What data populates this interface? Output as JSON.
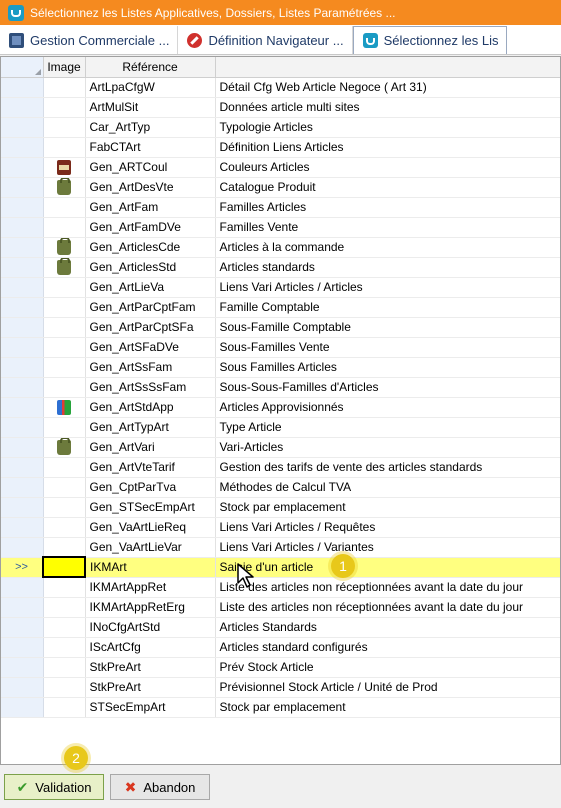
{
  "window": {
    "title": "Sélectionnez les Listes Applicatives, Dossiers, Listes Paramétrées ..."
  },
  "tabs": [
    {
      "label": "Gestion Commerciale ...",
      "icon": "cube-icon"
    },
    {
      "label": "Définition Navigateur ...",
      "icon": "no-entry-icon"
    },
    {
      "label": "Sélectionnez les Lis",
      "icon": "app-icon",
      "active": true
    }
  ],
  "grid": {
    "columns": {
      "image": "Image",
      "reference": "Référence",
      "description": ""
    },
    "current_marker": ">>",
    "rows": [
      {
        "ref": "ArtLpaCfgW",
        "desc": "Détail Cfg Web Article Negoce ( Art 31)",
        "icon": ""
      },
      {
        "ref": "ArtMulSit",
        "desc": "Données article multi sites",
        "icon": ""
      },
      {
        "ref": "Car_ArtTyp",
        "desc": "Typologie Articles",
        "icon": ""
      },
      {
        "ref": "FabCTArt",
        "desc": "Définition Liens Articles",
        "icon": ""
      },
      {
        "ref": "Gen_ARTCoul",
        "desc": "Couleurs Articles",
        "icon": "book"
      },
      {
        "ref": "Gen_ArtDesVte",
        "desc": "Catalogue Produit",
        "icon": "bag"
      },
      {
        "ref": "Gen_ArtFam",
        "desc": "Familles Articles",
        "icon": ""
      },
      {
        "ref": "Gen_ArtFamDVe",
        "desc": "Familles Vente",
        "icon": ""
      },
      {
        "ref": "Gen_ArticlesCde",
        "desc": "Articles à la commande",
        "icon": "bag"
      },
      {
        "ref": "Gen_ArticlesStd",
        "desc": "Articles standards",
        "icon": "bag"
      },
      {
        "ref": "Gen_ArtLieVa",
        "desc": "Liens Vari Articles / Articles",
        "icon": ""
      },
      {
        "ref": "Gen_ArtParCptFam",
        "desc": "Famille Comptable",
        "icon": ""
      },
      {
        "ref": "Gen_ArtParCptSFa",
        "desc": "Sous-Famille Comptable",
        "icon": ""
      },
      {
        "ref": "Gen_ArtSFaDVe",
        "desc": "Sous-Familles Vente",
        "icon": ""
      },
      {
        "ref": "Gen_ArtSsFam",
        "desc": "Sous Familles Articles",
        "icon": ""
      },
      {
        "ref": "Gen_ArtSsSsFam",
        "desc": "Sous-Sous-Familles d'Articles",
        "icon": ""
      },
      {
        "ref": "Gen_ArtStdApp",
        "desc": "Articles Approvisionnés",
        "icon": "books"
      },
      {
        "ref": "Gen_ArtTypArt",
        "desc": "Type Article",
        "icon": ""
      },
      {
        "ref": "Gen_ArtVari",
        "desc": "Vari-Articles",
        "icon": "bag"
      },
      {
        "ref": "Gen_ArtVteTarif",
        "desc": "Gestion des tarifs de vente des articles standards",
        "icon": ""
      },
      {
        "ref": "Gen_CptParTva",
        "desc": "Méthodes de Calcul TVA",
        "icon": ""
      },
      {
        "ref": "Gen_STSecEmpArt",
        "desc": "Stock par emplacement",
        "icon": ""
      },
      {
        "ref": "Gen_VaArtLieReq",
        "desc": "Liens Vari Articles / Requêtes",
        "icon": ""
      },
      {
        "ref": "Gen_VaArtLieVar",
        "desc": "Liens Vari Articles / Variantes",
        "icon": ""
      },
      {
        "ref": "IKMArt",
        "desc": "Saisie d'un article",
        "icon": "",
        "current": true
      },
      {
        "ref": "IKMArtAppRet",
        "desc": "Liste des articles non réceptionnées avant la date du jour",
        "icon": ""
      },
      {
        "ref": "IKMArtAppRetErg",
        "desc": "Liste des articles non réceptionnées avant la date du jour",
        "icon": ""
      },
      {
        "ref": "INoCfgArtStd",
        "desc": "Articles Standards",
        "icon": ""
      },
      {
        "ref": "IScArtCfg",
        "desc": "Articles standard configurés",
        "icon": ""
      },
      {
        "ref": "StkPreArt",
        "desc": "Prév Stock Article",
        "icon": ""
      },
      {
        "ref": "StkPreArt",
        "desc": "Prévisionnel Stock Article / Unité de Prod",
        "icon": ""
      },
      {
        "ref": "STSecEmpArt",
        "desc": "Stock par emplacement",
        "icon": ""
      }
    ]
  },
  "annotations": {
    "step1": "1",
    "step2": "2"
  },
  "footer": {
    "validate_label": "Validation",
    "cancel_label": "Abandon"
  },
  "colors": {
    "titlebar": "#f58a1f",
    "current_row": "#ffff80",
    "badge": "#e8c81a"
  }
}
